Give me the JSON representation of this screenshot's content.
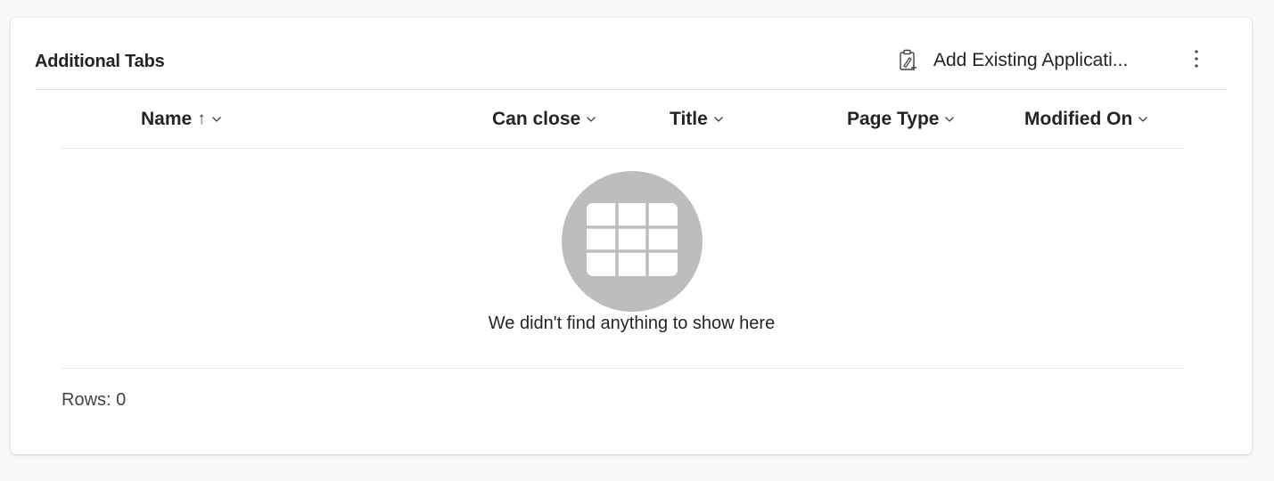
{
  "panel": {
    "title": "Additional Tabs",
    "add_existing_label": "Add Existing Applicati...",
    "add_existing_icon": "add-existing-icon",
    "more_icon": "more-vertical-icon"
  },
  "grid": {
    "columns": [
      {
        "label": "Name",
        "sort_indicator": "↑"
      },
      {
        "label": "Can close"
      },
      {
        "label": "Title"
      },
      {
        "label": "Page Type"
      },
      {
        "label": "Modified On"
      }
    ],
    "empty_message": "We didn't find anything to show here",
    "empty_icon": "empty-grid-icon",
    "footer": "Rows: 0"
  },
  "colors": {
    "empty_art_circle": "#bdbdbd",
    "divider": "#e1dfdd"
  }
}
